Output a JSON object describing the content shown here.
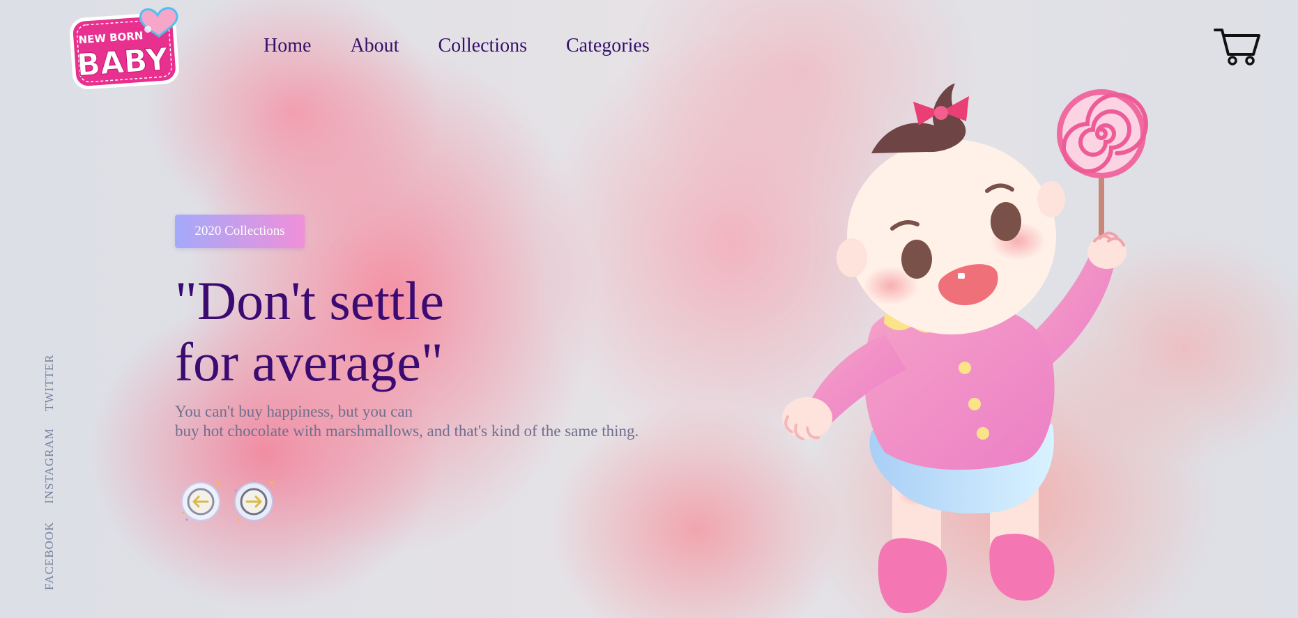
{
  "brand": {
    "logo_line1": "NEW BORN",
    "logo_line2": "BABY"
  },
  "nav": {
    "items": [
      {
        "label": "Home"
      },
      {
        "label": "About"
      },
      {
        "label": "Collections"
      },
      {
        "label": "Categories"
      }
    ]
  },
  "header": {
    "cart_icon": "shopping-cart-icon"
  },
  "hero": {
    "badge": "2020 Collections",
    "headline_line1": "\"Don't settle",
    "headline_line2": "for average\"",
    "sub_line1": "You can't buy happiness, but you can",
    "sub_line2": "buy hot chocolate with marshmallows, and that's kind of the same thing.",
    "prev_icon": "arrow-left-icon",
    "next_icon": "arrow-right-icon"
  },
  "social": {
    "twitter": "TWITTER",
    "instagram": "INSTAGRAM",
    "facebook": "FACEBOOK"
  },
  "colors": {
    "nav_text": "#35106a",
    "headline": "#3c0b72",
    "subtext": "#6f6f8e",
    "badge_from": "#a4a9fb",
    "badge_to": "#f08fd8",
    "logo_pink": "#e8308f"
  }
}
